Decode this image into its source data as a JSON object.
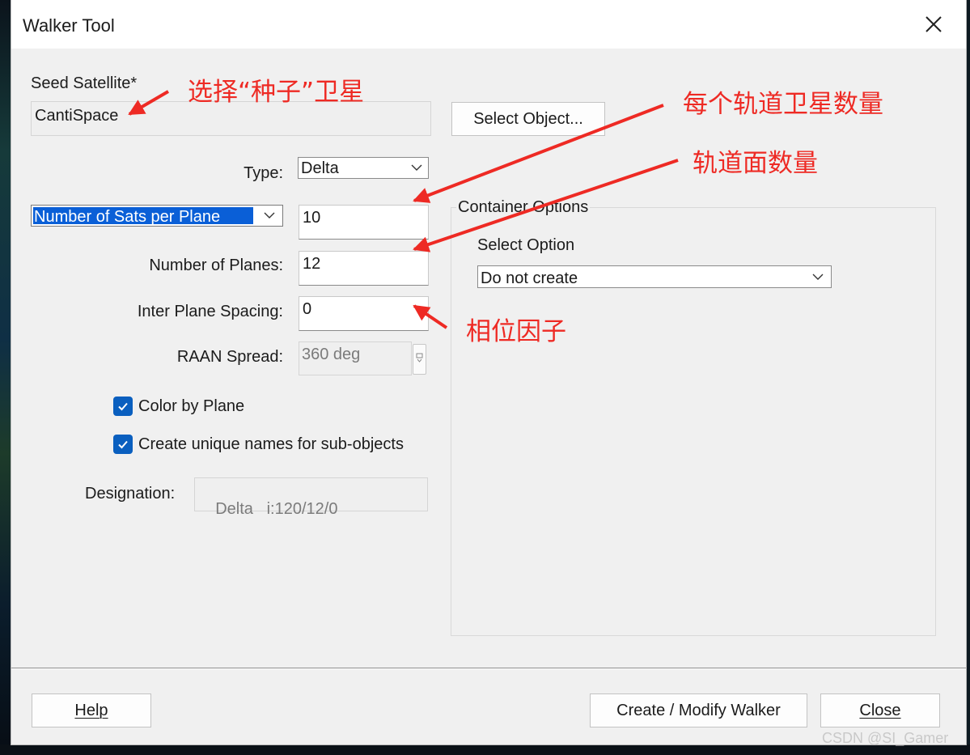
{
  "window": {
    "title": "Walker Tool"
  },
  "seed": {
    "label": "Seed Satellite*",
    "value": "CantiSpace",
    "select_object_label": "Select Object..."
  },
  "type": {
    "label": "Type:",
    "value": "Delta"
  },
  "sats_per_plane": {
    "selector": "Number of Sats per Plane",
    "value": "10"
  },
  "planes": {
    "label": "Number of Planes:",
    "value": "12"
  },
  "inter_plane": {
    "label": "Inter Plane Spacing:",
    "value": "0"
  },
  "raan": {
    "label": "RAAN Spread:",
    "value": "360 deg"
  },
  "options": {
    "color_by_plane": "Color by Plane",
    "unique_names": "Create unique names for sub-objects"
  },
  "designation": {
    "label": "Designation:",
    "value": "Delta   i:120/12/0"
  },
  "container": {
    "group_label": "Container Options",
    "select_option_label": "Select Option",
    "selected": "Do not create"
  },
  "buttons": {
    "help": "Help",
    "create_modify": "Create / Modify Walker",
    "close": "Close"
  },
  "annotations": {
    "seed": "选择“种子”卫星",
    "sats_per_plane": "每个轨道卫星数量",
    "planes": "轨道面数量",
    "phase": "相位因子"
  },
  "watermark": "CSDN @SI_Gamer",
  "colors": {
    "accent": "#0a5fbf",
    "annotation": "#ee2a24",
    "dialog_bg": "#f0f0f0"
  },
  "icons": {
    "close": "close-icon",
    "dropdown": "chevron-down-icon",
    "checkbox": "checkmark-icon"
  }
}
